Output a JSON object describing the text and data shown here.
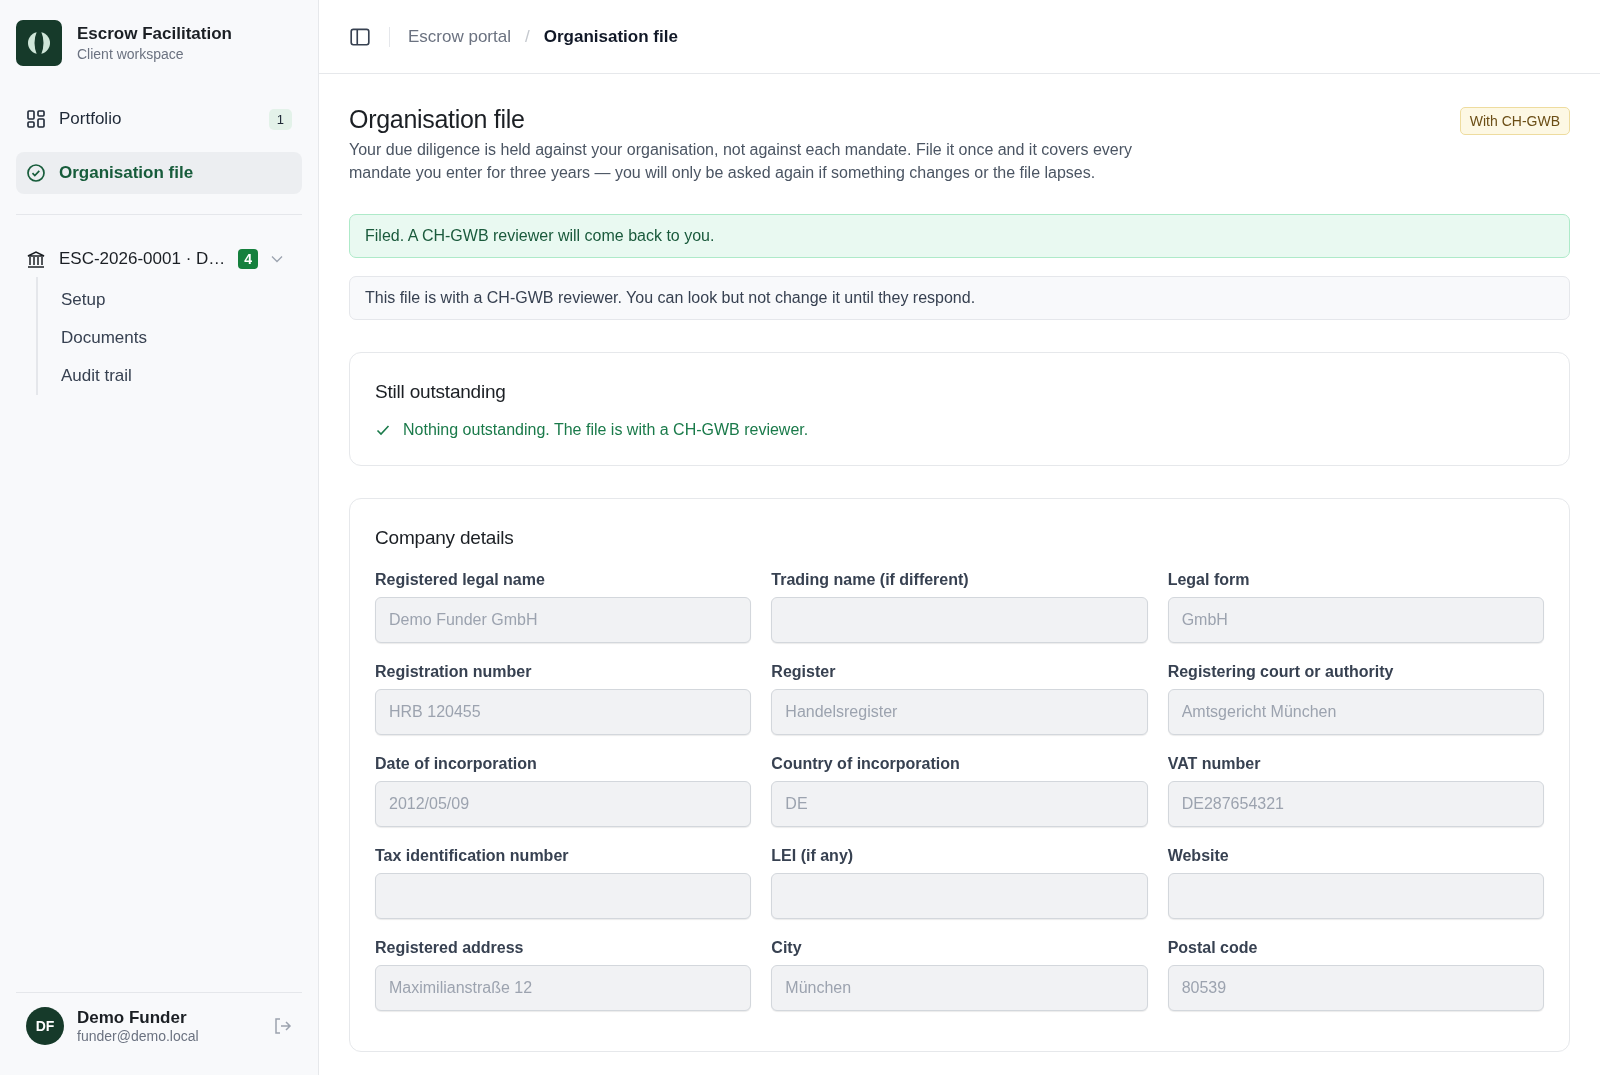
{
  "brand": {
    "title": "Escrow Facilitation",
    "subtitle": "Client workspace"
  },
  "nav": [
    {
      "label": "Portfolio",
      "kind": "grid",
      "badge": "1",
      "selected": false
    },
    {
      "label": "Organisation file",
      "kind": "check",
      "selected": true
    }
  ],
  "mandate": {
    "label": "ESC-2026-0001 · D…",
    "badge": "4",
    "expanded": true,
    "children": [
      {
        "label": "Setup"
      },
      {
        "label": "Documents"
      },
      {
        "label": "Audit trail"
      }
    ]
  },
  "user": {
    "initials": "DF",
    "name": "Demo Funder",
    "email": "funder@demo.local"
  },
  "breadcrumb": {
    "separator": "/",
    "items": [
      {
        "label": "Escrow portal",
        "current": false
      },
      {
        "label": "Organisation file",
        "current": true
      }
    ]
  },
  "page": {
    "title": "Organisation file",
    "status": "With CH-GWB",
    "intro": "Your due diligence is held against your organisation, not against each mandate. File it once and it covers every mandate you enter for three years — you will only be asked again if something changes or the file lapses."
  },
  "alerts": [
    {
      "kind": "success",
      "text": "Filed. A CH-GWB reviewer will come back to you."
    },
    {
      "kind": "info",
      "text": "This file is with a CH-GWB reviewer. You can look but not change it until they respond."
    }
  ],
  "outstanding": {
    "title": "Still outstanding",
    "done": true,
    "text": "Nothing outstanding. The file is with a CH-GWB reviewer."
  },
  "company_details": {
    "title": "Company details",
    "fields": [
      {
        "label": "Registered legal name",
        "value": "Demo Funder GmbH",
        "disabled": true
      },
      {
        "label": "Trading name (if different)",
        "disabled": true
      },
      {
        "label": "Legal form",
        "value": "GmbH",
        "disabled": true
      },
      {
        "label": "Registration number",
        "value": "HRB 120455",
        "disabled": true
      },
      {
        "label": "Register",
        "value": "Handelsregister",
        "disabled": true
      },
      {
        "label": "Registering court or authority",
        "value": "Amtsgericht München",
        "disabled": true
      },
      {
        "label": "Date of incorporation",
        "value": "2012/05/09",
        "disabled": true
      },
      {
        "label": "Country of incorporation",
        "value": "DE",
        "disabled": true
      },
      {
        "label": "VAT number",
        "value": "DE287654321",
        "disabled": true
      },
      {
        "label": "Tax identification number",
        "disabled": true
      },
      {
        "label": "LEI (if any)",
        "disabled": true
      },
      {
        "label": "Website",
        "disabled": true
      },
      {
        "label": "Registered address",
        "value": "Maximilianstraße 12",
        "disabled": true
      },
      {
        "label": "City",
        "value": "München",
        "disabled": true
      },
      {
        "label": "Postal code",
        "value": "80539",
        "disabled": true
      }
    ]
  }
}
